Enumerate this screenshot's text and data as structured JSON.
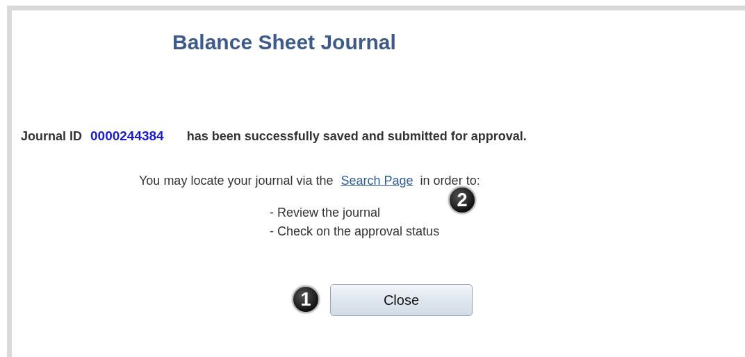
{
  "title": "Balance Sheet Journal",
  "message": {
    "label": "Journal ID",
    "journal_id": "0000244384",
    "text": "has been successfully saved and submitted for approval."
  },
  "locate": {
    "before": "You may locate your journal via the",
    "link": "Search Page",
    "after": "in order to:",
    "callout": "2"
  },
  "actions": [
    "- Review the journal",
    "- Check on the approval status"
  ],
  "close": {
    "label": "Close",
    "callout": "1"
  }
}
